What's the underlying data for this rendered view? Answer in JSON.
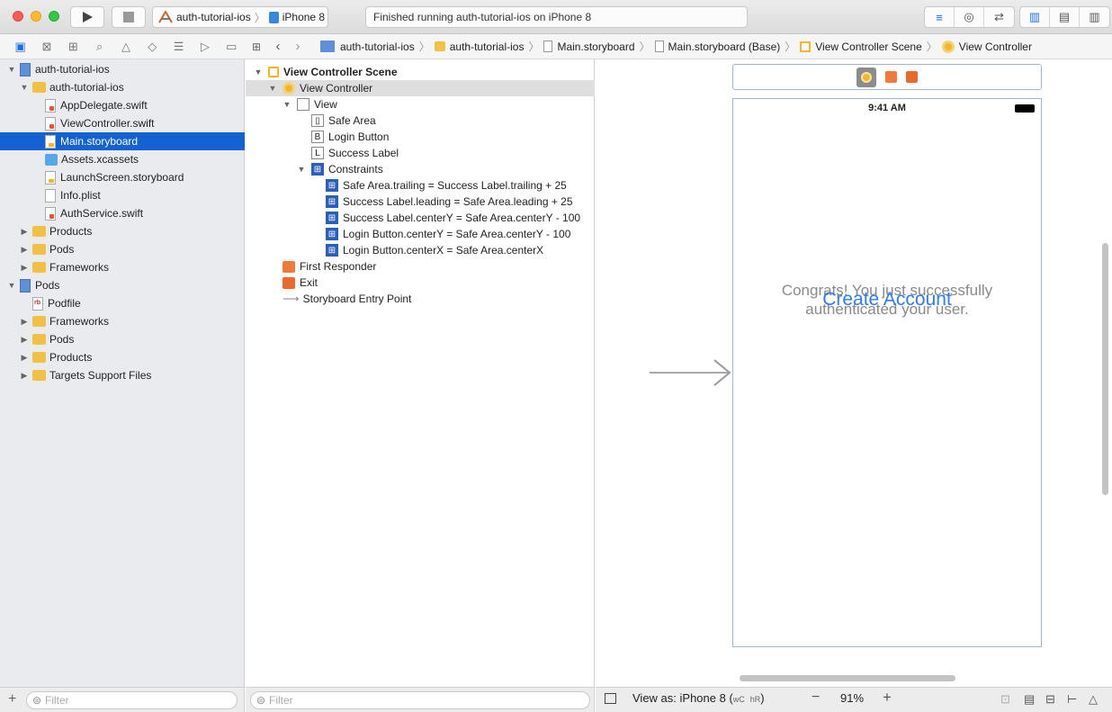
{
  "toolbar": {
    "scheme": "auth-tutorial-ios",
    "device": "iPhone 8",
    "status": "Finished running auth-tutorial-ios on iPhone 8"
  },
  "navigator": {
    "items": [
      {
        "label": "auth-tutorial-ios",
        "icon": "project-file-icon",
        "indent": 0,
        "tri": "▼",
        "kind": "proj"
      },
      {
        "label": "auth-tutorial-ios",
        "icon": "folder-icon",
        "indent": 1,
        "tri": "▼",
        "kind": "folder"
      },
      {
        "label": "AppDelegate.swift",
        "icon": "swift-file-icon",
        "indent": 2,
        "tri": "",
        "kind": "swift"
      },
      {
        "label": "ViewController.swift",
        "icon": "swift-file-icon",
        "indent": 2,
        "tri": "",
        "kind": "swift"
      },
      {
        "label": "Main.storyboard",
        "icon": "storyboard-file-icon",
        "indent": 2,
        "tri": "",
        "kind": "sb",
        "selected": true
      },
      {
        "label": "Assets.xcassets",
        "icon": "asset-catalog-icon",
        "indent": 2,
        "tri": "",
        "kind": "assets"
      },
      {
        "label": "LaunchScreen.storyboard",
        "icon": "storyboard-file-icon",
        "indent": 2,
        "tri": "",
        "kind": "sb"
      },
      {
        "label": "Info.plist",
        "icon": "plist-file-icon",
        "indent": 2,
        "tri": "",
        "kind": "plain"
      },
      {
        "label": "AuthService.swift",
        "icon": "swift-file-icon",
        "indent": 2,
        "tri": "",
        "kind": "swift"
      },
      {
        "label": "Products",
        "icon": "folder-icon",
        "indent": 1,
        "tri": "▶",
        "kind": "folder"
      },
      {
        "label": "Pods",
        "icon": "folder-icon",
        "indent": 1,
        "tri": "▶",
        "kind": "folder"
      },
      {
        "label": "Frameworks",
        "icon": "folder-icon",
        "indent": 1,
        "tri": "▶",
        "kind": "folder"
      },
      {
        "label": "Pods",
        "icon": "project-file-icon",
        "indent": 0,
        "tri": "▼",
        "kind": "proj"
      },
      {
        "label": "Podfile",
        "icon": "ruby-file-icon",
        "indent": 1,
        "tri": "",
        "kind": "rb"
      },
      {
        "label": "Frameworks",
        "icon": "folder-icon",
        "indent": 1,
        "tri": "▶",
        "kind": "folder"
      },
      {
        "label": "Pods",
        "icon": "folder-icon",
        "indent": 1,
        "tri": "▶",
        "kind": "folder"
      },
      {
        "label": "Products",
        "icon": "folder-icon",
        "indent": 1,
        "tri": "▶",
        "kind": "folder"
      },
      {
        "label": "Targets Support Files",
        "icon": "folder-icon",
        "indent": 1,
        "tri": "▶",
        "kind": "folder"
      }
    ],
    "filter_placeholder": "Filter"
  },
  "jumpbar": {
    "crumbs": [
      "auth-tutorial-ios",
      "auth-tutorial-ios",
      "Main.storyboard",
      "Main.storyboard (Base)",
      "View Controller Scene",
      "View Controller"
    ]
  },
  "outline": {
    "rows": [
      {
        "label": "View Controller Scene",
        "indent": 0,
        "tri": "▼",
        "icon": "scene-icon",
        "bold": true
      },
      {
        "label": "View Controller",
        "indent": 1,
        "tri": "▼",
        "icon": "view-controller-icon",
        "highlight": true
      },
      {
        "label": "View",
        "indent": 2,
        "tri": "▼",
        "icon": "view-icon"
      },
      {
        "label": "Safe Area",
        "indent": 3,
        "tri": "",
        "icon": "safe-area-icon",
        "glyph": "▯"
      },
      {
        "label": "Login Button",
        "indent": 3,
        "tri": "",
        "icon": "button-icon",
        "glyph": "B"
      },
      {
        "label": "Success Label",
        "indent": 3,
        "tri": "",
        "icon": "label-icon",
        "glyph": "L"
      },
      {
        "label": "Constraints",
        "indent": 3,
        "tri": "▼",
        "icon": "constraints-icon",
        "con": true
      },
      {
        "label": "Safe Area.trailing = Success Label.trailing + 25",
        "indent": 4,
        "tri": "",
        "icon": "constraint-icon",
        "con": true
      },
      {
        "label": "Success Label.leading = Safe Area.leading + 25",
        "indent": 4,
        "tri": "",
        "icon": "constraint-icon",
        "con": true
      },
      {
        "label": "Success Label.centerY = Safe Area.centerY - 100",
        "indent": 4,
        "tri": "",
        "icon": "constraint-icon",
        "con": true
      },
      {
        "label": "Login Button.centerY = Safe Area.centerY - 100",
        "indent": 4,
        "tri": "",
        "icon": "constraint-icon",
        "con": true
      },
      {
        "label": "Login Button.centerX = Safe Area.centerX",
        "indent": 4,
        "tri": "",
        "icon": "constraint-icon",
        "con": true
      },
      {
        "label": "First Responder",
        "indent": 1,
        "tri": "",
        "icon": "first-responder-icon"
      },
      {
        "label": "Exit",
        "indent": 1,
        "tri": "",
        "icon": "exit-icon"
      },
      {
        "label": "Storyboard Entry Point",
        "indent": 1,
        "tri": "",
        "icon": "entry-point-icon"
      }
    ],
    "filter_placeholder": "Filter"
  },
  "canvas": {
    "time": "9:41 AM",
    "success_label": "Congrats! You just successfully authenticated your user.",
    "login_button": "Create Account",
    "button_color": "#2f7cf6",
    "label_color": "#8a8a8a"
  },
  "bottom": {
    "view_as": "View as: iPhone 8 (",
    "wc": "wC",
    "hr": "hR",
    "close_paren": ")",
    "zoom": "91%"
  }
}
